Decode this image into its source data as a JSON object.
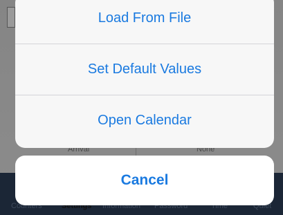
{
  "action_sheet": {
    "items": [
      {
        "label": "Load From File"
      },
      {
        "label": "Set Default Values"
      },
      {
        "label": "Open Calendar"
      }
    ],
    "cancel_label": "Cancel",
    "accent_color": "#1a7ae0"
  },
  "background": {
    "row_left": "Arrival",
    "row_right": "None"
  },
  "tab_bar": {
    "tabs": [
      {
        "label": "Counters"
      },
      {
        "label": "Settings",
        "active": true
      },
      {
        "label": "Information"
      },
      {
        "label": "Password"
      },
      {
        "label": "Time"
      },
      {
        "label": "Quiet"
      }
    ]
  }
}
